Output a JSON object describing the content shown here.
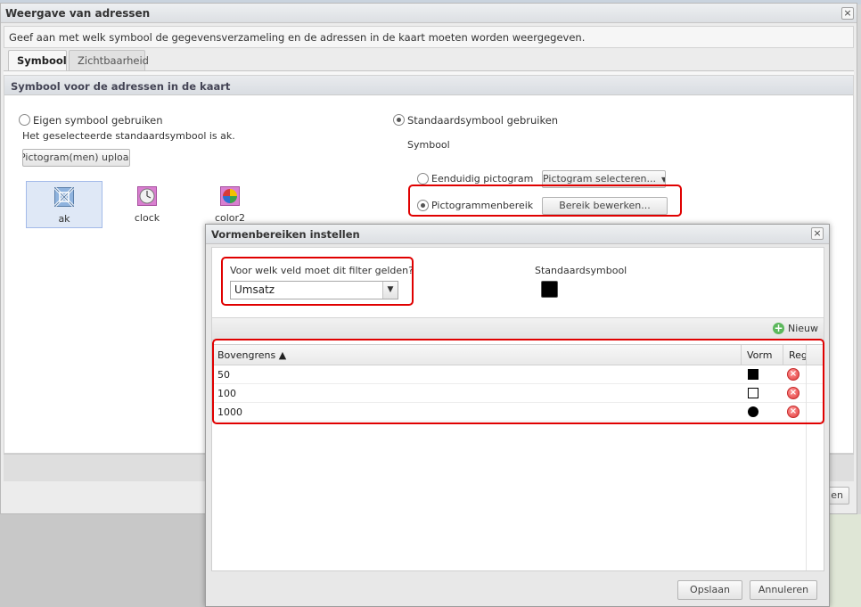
{
  "window": {
    "title": "Weergave van adressen",
    "description": "Geef aan met welk symbool de gegevensverzameling en de adressen in de kaart moeten worden weergegeven.",
    "close_glyph": "×",
    "tabs": [
      {
        "label": "Symbool",
        "active": true
      },
      {
        "label": "Zichtbaarheid",
        "active": false
      }
    ],
    "panel_title": "Symbool voor de adressen in de kaart",
    "own_symbol": {
      "label": "Eigen symbool gebruiken",
      "info": "Het geselecteerde standaardsymbool is ak.",
      "upload_button": "Pictogram(men) uploaden",
      "icons": [
        {
          "label": "ak",
          "icon": "cross-pattern-icon",
          "selected": true
        },
        {
          "label": "clock",
          "icon": "clock-icon",
          "selected": false
        },
        {
          "label": "color2",
          "icon": "color-wheel-icon",
          "selected": false
        }
      ]
    },
    "standard_symbol": {
      "label": "Standaardsymbool gebruiken",
      "symbol_label": "Symbool",
      "single_option": "Eenduidig pictogram",
      "single_button": "Pictogram selecteren...",
      "range_option": "Pictogrammenbereik",
      "range_button": "Bereik bewerken..."
    },
    "footer_button_partial": "en"
  },
  "dialog": {
    "title": "Vormenbereiken instellen",
    "close_glyph": "×",
    "field_question": "Voor welk veld moet dit filter gelden?",
    "field_value": "Umsatz",
    "default_symbol_label": "Standaardsymbool",
    "new_button": "Nieuw",
    "columns": [
      {
        "label": "Bovengrens ▲"
      },
      {
        "label": "Vorm"
      },
      {
        "label": "Reg"
      }
    ],
    "rows": [
      {
        "upper": "50",
        "shape": "square-filled"
      },
      {
        "upper": "100",
        "shape": "square-open"
      },
      {
        "upper": "1000",
        "shape": "circle-filled"
      }
    ],
    "save_button": "Opslaan",
    "cancel_button": "Annuleren"
  },
  "colors": {
    "highlight": "#e00000",
    "selected_bg": "#dfe8f6"
  }
}
